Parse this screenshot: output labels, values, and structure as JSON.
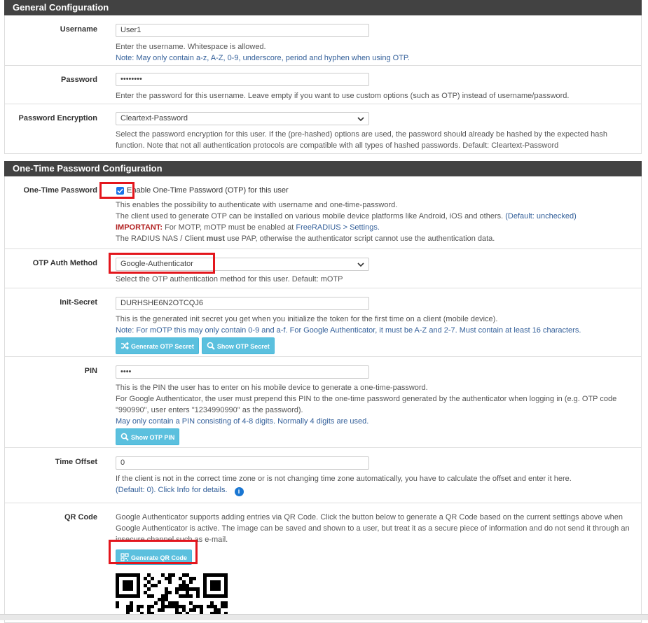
{
  "general": {
    "title": "General Configuration",
    "username": {
      "label": "Username",
      "value": "User1",
      "help1": "Enter the username. Whitespace is allowed.",
      "help2": "Note: May only contain a-z, A-Z, 0-9, underscore, period and hyphen when using OTP."
    },
    "password": {
      "label": "Password",
      "value": "••••••••",
      "help": "Enter the password for this username. Leave empty if you want to use custom options (such as OTP) instead of username/password."
    },
    "encryption": {
      "label": "Password Encryption",
      "value": "Cleartext-Password",
      "help": "Select the password encryption for this user. If the (pre-hashed) options are used, the password should already be hashed by the expected hash function. Note that not all authentication protocols are compatible with all types of hashed passwords. Default: Cleartext-Password"
    }
  },
  "otp": {
    "title": "One-Time Password Configuration",
    "enable": {
      "label": "One-Time Password",
      "checkbox_label": "Enable One-Time Password (OTP) for this user",
      "help1": "This enables the possibility to authenticate with username and one-time-password.",
      "help2": "The client used to generate OTP can be installed on various mobile device platforms like Android, iOS and others.",
      "help2_default": "(Default: unchecked)",
      "important_label": "IMPORTANT:",
      "important_text": "For MOTP, mOTP must be enabled at",
      "important_link": "FreeRADIUS > Settings.",
      "help4_a": "The RADIUS NAS / Client",
      "help4_must": "must",
      "help4_b": "use PAP, otherwise the authenticator script cannot use the authentication data."
    },
    "method": {
      "label": "OTP Auth Method",
      "value": "Google-Authenticator",
      "help": "Select the OTP authentication method for this user. Default: mOTP"
    },
    "secret": {
      "label": "Init-Secret",
      "value": "DURHSHE6N2OTCQJ6",
      "help1": "This is the generated init secret you get when you initialize the token for the first time on a client (mobile device).",
      "help2": "Note: For mOTP this may only contain 0-9 and a-f. For Google Authenticator, it must be A-Z and 2-7. Must contain at least 16 characters.",
      "btn_generate": "Generate OTP Secret",
      "btn_show": "Show OTP Secret"
    },
    "pin": {
      "label": "PIN",
      "value": "••••",
      "help1": "This is the PIN the user has to enter on his mobile device to generate a one-time-password.",
      "help2": "For Google Authenticator, the user must prepend this PIN to the one-time password generated by the authenticator when logging in (e.g. OTP code \"990990\", user enters \"1234990990\" as the password).",
      "help3": "May only contain a PIN consisting of 4-8 digits. Normally 4 digits are used.",
      "btn_show": "Show OTP PIN"
    },
    "offset": {
      "label": "Time Offset",
      "value": "0",
      "help1": "If the client is not in the correct time zone or is not changing time zone automatically, you have to calculate the offset and enter it here.",
      "help2": "(Default: 0). Click Info for details."
    },
    "qr": {
      "label": "QR Code",
      "help": "Google Authenticator supports adding entries via QR Code. Click the button below to generate a QR Code based on the current settings above when Google Authenticator is active. The image can be saved and shown to a user, but treat it as a secure piece of information and do not send it through an insecure channel such as e-mail.",
      "btn_generate": "Generate QR Code"
    }
  },
  "colors": {
    "header_bg": "#424242",
    "button_bg": "#5bc0de",
    "highlight": "#e3161d",
    "help_blue": "#34609a",
    "important_red": "#b22222"
  }
}
